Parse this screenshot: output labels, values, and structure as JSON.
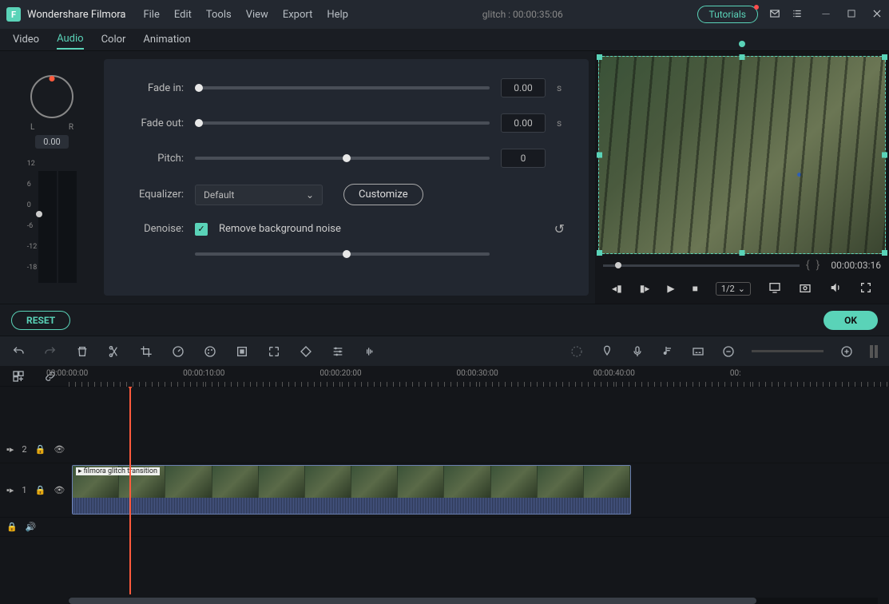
{
  "app": {
    "name": "Wondershare Filmora"
  },
  "menu": {
    "file": "File",
    "edit": "Edit",
    "tools": "Tools",
    "view": "View",
    "export": "Export",
    "help": "Help"
  },
  "project": {
    "title": "glitch : 00:00:35:06"
  },
  "header": {
    "tutorials": "Tutorials"
  },
  "tabs": {
    "video": "Video",
    "audio": "Audio",
    "color": "Color",
    "animation": "Animation",
    "active": "Audio"
  },
  "pan": {
    "left": "L",
    "right": "R",
    "value": "0.00"
  },
  "meter_ticks": [
    "12",
    "6",
    "0",
    "-6",
    "-12",
    "-18"
  ],
  "audio": {
    "fade_in_label": "Fade in:",
    "fade_in_val": "0.00",
    "fade_in_unit": "s",
    "fade_out_label": "Fade out:",
    "fade_out_val": "0.00",
    "fade_out_unit": "s",
    "pitch_label": "Pitch:",
    "pitch_val": "0",
    "equalizer_label": "Equalizer:",
    "equalizer_val": "Default",
    "customize": "Customize",
    "denoise_label": "Denoise:",
    "denoise_check": "Remove background noise"
  },
  "buttons": {
    "reset": "RESET",
    "ok": "OK"
  },
  "preview": {
    "time": "00:00:03:16",
    "speed": "1/2"
  },
  "timeline": {
    "ticks": [
      "00:00:00:00",
      "00:00:10:00",
      "00:00:20:00",
      "00:00:30:00",
      "00:00:40:00",
      "00:"
    ],
    "clip_name": "filmora glitch transition",
    "track2": "2",
    "track1": "1"
  }
}
